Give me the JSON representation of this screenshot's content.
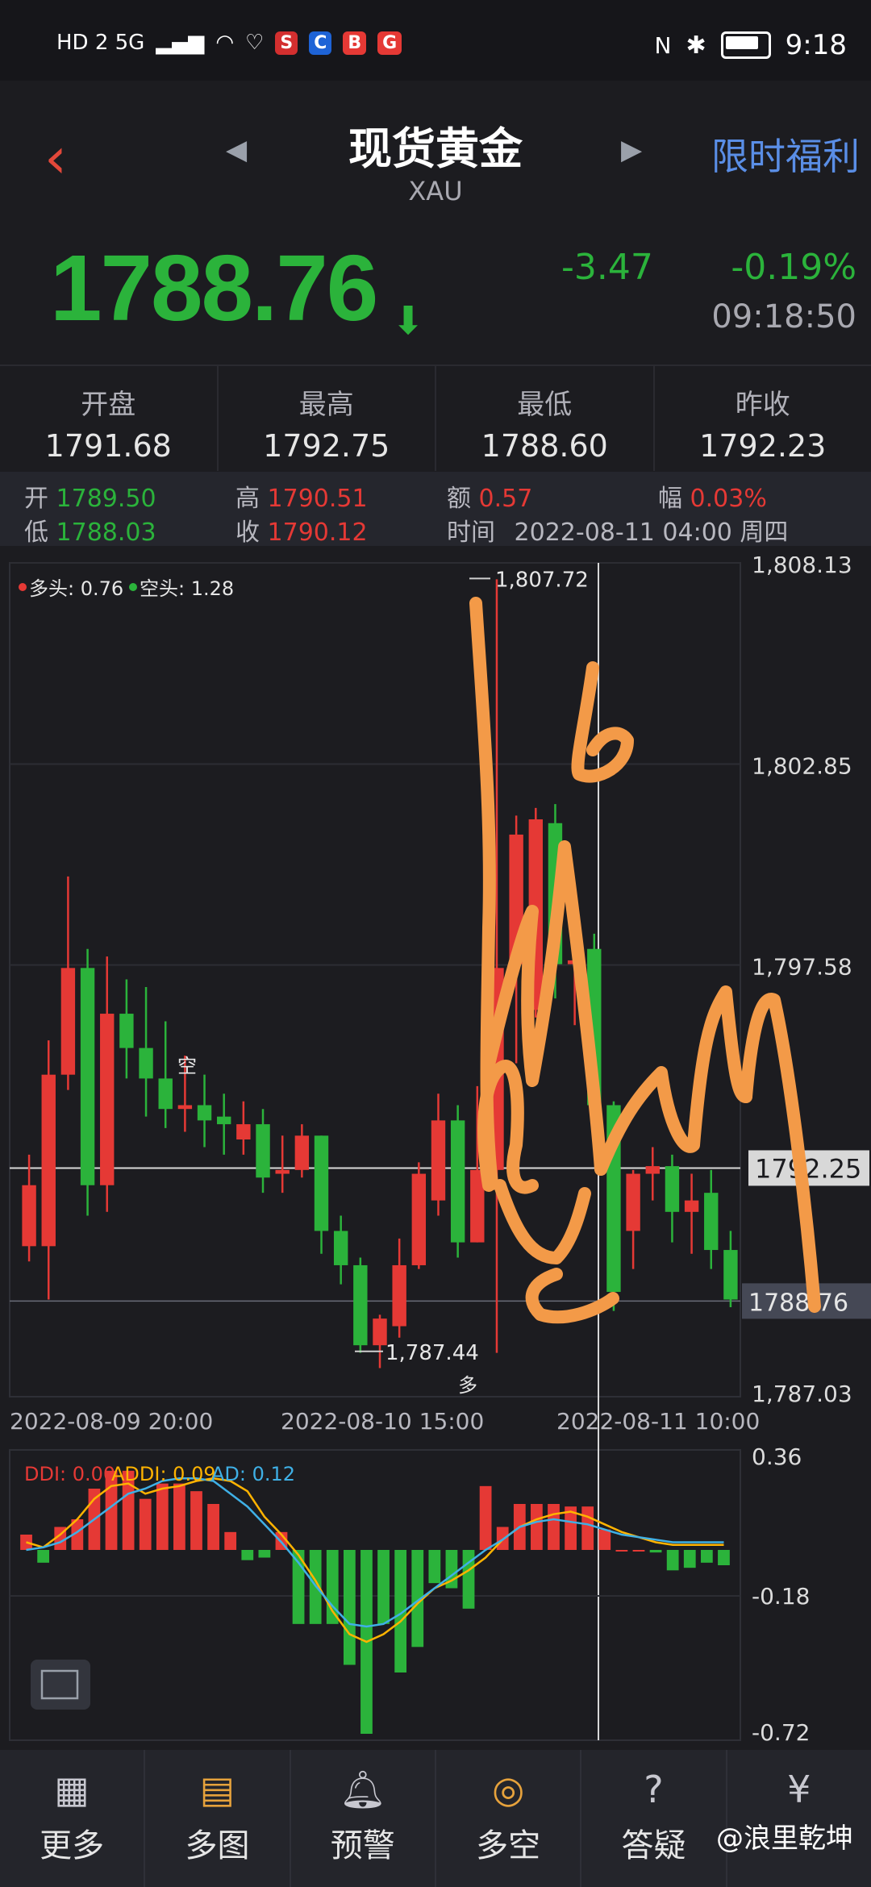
{
  "status_bar": {
    "left_text": "HD 2  5G",
    "time": "9:18"
  },
  "header": {
    "title": "现货黄金",
    "subtitle": "XAU",
    "promo": "限时福利"
  },
  "quote": {
    "price": "1788.76",
    "change": "-3.47",
    "change_pct": "-0.19%",
    "time": "09:18:50"
  },
  "summary": [
    {
      "label": "开盘",
      "value": "1791.68"
    },
    {
      "label": "最高",
      "value": "1792.75"
    },
    {
      "label": "最低",
      "value": "1788.60"
    },
    {
      "label": "昨收",
      "value": "1792.23"
    }
  ],
  "ohlc": {
    "open_label": "开",
    "open": "1789.50",
    "high_label": "高",
    "high": "1790.51",
    "amount_label": "额",
    "amount": "0.57",
    "range_label": "幅",
    "range": "0.03%",
    "low_label": "低",
    "low": "1788.03",
    "close_label": "收",
    "close": "1790.12",
    "time_label": "时间",
    "time": "2022-08-11 04:00 周四"
  },
  "chart_data": [
    {
      "type": "candlestick",
      "legend": [
        {
          "name": "多头: 0.76",
          "color": "#e53935"
        },
        {
          "name": "空头: 1.28",
          "color": "#2bb33b"
        }
      ],
      "y_ticks": [
        "1,808.13",
        "1,802.85",
        "1,797.58",
        "1792.25",
        "1788.76",
        "1,787.03"
      ],
      "ylim": [
        1786.25,
        1808.13
      ],
      "x_labels": [
        "2022-08-09 20:00",
        "2022-08-10 15:00",
        "2022-08-11 10:00"
      ],
      "annotations": {
        "high": "1,807.72",
        "low": "1,787.44",
        "mark_short": "空",
        "mark_long": "多"
      },
      "crosshair_price": "1792.25",
      "current_price": "1788.76",
      "candles": [
        {
          "o": 1790.2,
          "c": 1791.8,
          "h": 1792.6,
          "l": 1789.8
        },
        {
          "o": 1790.2,
          "c": 1794.7,
          "h": 1795.6,
          "l": 1788.8
        },
        {
          "o": 1794.7,
          "c": 1797.5,
          "h": 1799.9,
          "l": 1794.3
        },
        {
          "o": 1797.5,
          "c": 1791.8,
          "h": 1798.0,
          "l": 1791.0
        },
        {
          "o": 1791.8,
          "c": 1796.3,
          "h": 1797.8,
          "l": 1791.1
        },
        {
          "o": 1796.3,
          "c": 1795.4,
          "h": 1797.2,
          "l": 1794.6
        },
        {
          "o": 1795.4,
          "c": 1794.6,
          "h": 1797.0,
          "l": 1793.6
        },
        {
          "o": 1794.6,
          "c": 1793.8,
          "h": 1796.1,
          "l": 1793.3
        },
        {
          "o": 1793.8,
          "c": 1793.9,
          "h": 1795.2,
          "l": 1793.2
        },
        {
          "o": 1793.9,
          "c": 1793.5,
          "h": 1794.7,
          "l": 1792.8
        },
        {
          "o": 1793.6,
          "c": 1793.4,
          "h": 1794.2,
          "l": 1792.6
        },
        {
          "o": 1793.0,
          "c": 1793.4,
          "h": 1794.0,
          "l": 1792.6
        },
        {
          "o": 1793.4,
          "c": 1792.0,
          "h": 1793.8,
          "l": 1791.6
        },
        {
          "o": 1792.1,
          "c": 1792.2,
          "h": 1793.1,
          "l": 1791.6
        },
        {
          "o": 1792.2,
          "c": 1793.1,
          "h": 1793.4,
          "l": 1792.0
        },
        {
          "o": 1793.1,
          "c": 1790.6,
          "h": 1793.1,
          "l": 1790.0
        },
        {
          "o": 1790.6,
          "c": 1789.7,
          "h": 1791.0,
          "l": 1789.2
        },
        {
          "o": 1789.7,
          "c": 1787.6,
          "h": 1789.9,
          "l": 1787.4
        },
        {
          "o": 1787.6,
          "c": 1788.3,
          "h": 1788.4,
          "l": 1787.0
        },
        {
          "o": 1788.1,
          "c": 1789.7,
          "h": 1790.4,
          "l": 1787.8
        },
        {
          "o": 1789.7,
          "c": 1792.1,
          "h": 1792.4,
          "l": 1789.6
        },
        {
          "o": 1791.4,
          "c": 1793.5,
          "h": 1794.2,
          "l": 1791.0
        },
        {
          "o": 1793.5,
          "c": 1790.3,
          "h": 1793.9,
          "l": 1789.9
        },
        {
          "o": 1790.3,
          "c": 1792.2,
          "h": 1794.4,
          "l": 1790.3
        },
        {
          "o": 1792.2,
          "c": 1797.5,
          "h": 1807.7,
          "l": 1787.4
        },
        {
          "o": 1797.6,
          "c": 1801.0,
          "h": 1801.5,
          "l": 1795.0
        },
        {
          "o": 1796.4,
          "c": 1801.4,
          "h": 1801.7,
          "l": 1796.2
        },
        {
          "o": 1801.3,
          "c": 1797.6,
          "h": 1801.8,
          "l": 1796.7
        },
        {
          "o": 1797.6,
          "c": 1797.7,
          "h": 1798.3,
          "l": 1796.0
        },
        {
          "o": 1798.0,
          "c": 1793.9,
          "h": 1798.4,
          "l": 1793.5
        },
        {
          "o": 1793.9,
          "c": 1789.0,
          "h": 1794.0,
          "l": 1788.5
        },
        {
          "o": 1790.6,
          "c": 1792.1,
          "h": 1792.2,
          "l": 1789.6
        },
        {
          "o": 1792.1,
          "c": 1792.3,
          "h": 1792.8,
          "l": 1791.4
        },
        {
          "o": 1792.3,
          "c": 1791.1,
          "h": 1792.6,
          "l": 1790.3
        },
        {
          "o": 1791.1,
          "c": 1791.4,
          "h": 1792.1,
          "l": 1790.0
        },
        {
          "o": 1791.6,
          "c": 1790.1,
          "h": 1792.2,
          "l": 1789.6
        },
        {
          "o": 1790.1,
          "c": 1788.8,
          "h": 1790.6,
          "l": 1788.6
        }
      ]
    },
    {
      "type": "bar",
      "legend": [
        {
          "name": "DDI: 0.00",
          "color": "#e53935"
        },
        {
          "name": "ADDI: 0.09",
          "color": "#ffb300"
        },
        {
          "name": "AD: 0.12",
          "color": "#3fb0e6"
        }
      ],
      "y_ticks": [
        "0.36",
        "-0.18",
        "-0.72"
      ],
      "ylim": [
        -0.72,
        0.36
      ],
      "bars": [
        0.06,
        -0.05,
        0.09,
        0.12,
        0.24,
        0.31,
        0.31,
        0.2,
        0.26,
        0.26,
        0.23,
        0.18,
        0.07,
        -0.04,
        -0.03,
        0.07,
        -0.29,
        -0.29,
        -0.29,
        -0.45,
        -0.72,
        -0.29,
        -0.48,
        -0.38,
        -0.13,
        -0.15,
        -0.23,
        0.25,
        0.09,
        0.18,
        0.18,
        0.18,
        0.17,
        0.17,
        0.08,
        0.0,
        0.0,
        -0.01,
        -0.08,
        -0.07,
        -0.05,
        -0.06
      ],
      "addi": [
        0.03,
        0.01,
        0.06,
        0.12,
        0.2,
        0.25,
        0.26,
        0.22,
        0.24,
        0.25,
        0.27,
        0.28,
        0.27,
        0.23,
        0.13,
        0.06,
        -0.02,
        -0.12,
        -0.24,
        -0.33,
        -0.36,
        -0.33,
        -0.28,
        -0.21,
        -0.15,
        -0.12,
        -0.08,
        -0.03,
        0.04,
        0.09,
        0.12,
        0.14,
        0.15,
        0.13,
        0.1,
        0.07,
        0.05,
        0.03,
        0.02,
        0.02,
        0.02,
        0.02
      ],
      "ad": [
        0.0,
        0.01,
        0.03,
        0.07,
        0.12,
        0.17,
        0.22,
        0.24,
        0.27,
        0.28,
        0.28,
        0.27,
        0.22,
        0.17,
        0.1,
        0.03,
        -0.05,
        -0.14,
        -0.22,
        -0.29,
        -0.3,
        -0.29,
        -0.25,
        -0.2,
        -0.15,
        -0.1,
        -0.05,
        0.0,
        0.04,
        0.09,
        0.11,
        0.12,
        0.11,
        0.1,
        0.08,
        0.06,
        0.05,
        0.04,
        0.03,
        0.03,
        0.03,
        0.03
      ]
    }
  ],
  "bottom_nav": [
    {
      "label": "更多",
      "icon": "grid-icon"
    },
    {
      "label": "多图",
      "icon": "chart-icon"
    },
    {
      "label": "预警",
      "icon": "bell-icon"
    },
    {
      "label": "多空",
      "icon": "trend-icon"
    },
    {
      "label": "答疑",
      "icon": "question-icon"
    },
    {
      "label": "",
      "icon": "bag-icon"
    }
  ],
  "watermark": "@浪里乾坤",
  "colors": {
    "up": "#e53935",
    "down": "#2bb33b",
    "annotation": "#f39a48"
  }
}
